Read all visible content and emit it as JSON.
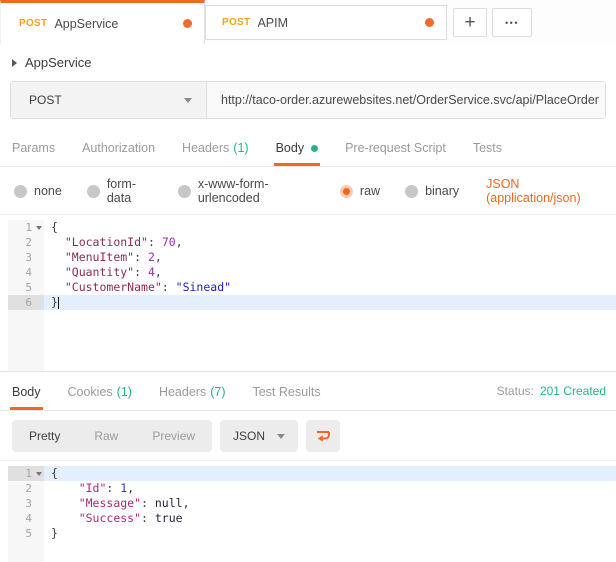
{
  "colors": {
    "accent_orange": "#F26722",
    "method_orange": "#F9A11B",
    "green": "#26B47F",
    "active_line_blue": "#E3EFFC"
  },
  "tabbar": {
    "tabs": [
      {
        "method": "POST",
        "title": "AppService",
        "modified": true,
        "active": true
      },
      {
        "method": "POST",
        "title": "APIM",
        "modified": true,
        "active": false
      }
    ],
    "new_tab_label": "+",
    "more_label": "•••"
  },
  "breadcrumb": {
    "title": "AppService"
  },
  "request": {
    "method": "POST",
    "url": "http://taco-order.azurewebsites.net/OrderService.svc/api/PlaceOrder",
    "tabs": [
      {
        "label": "Params"
      },
      {
        "label": "Authorization"
      },
      {
        "label": "Headers",
        "count": "(1)"
      },
      {
        "label": "Body",
        "modified": true,
        "active": true
      },
      {
        "label": "Pre-request Script"
      },
      {
        "label": "Tests"
      }
    ],
    "body_modes": [
      {
        "label": "none"
      },
      {
        "label": "form-data"
      },
      {
        "label": "x-www-form-urlencoded"
      },
      {
        "label": "raw",
        "selected": true
      },
      {
        "label": "binary"
      }
    ],
    "content_type": "JSON (application/json)",
    "body_lines": [
      {
        "num": 1,
        "fold": true,
        "tokens": [
          {
            "t": "{",
            "c": "pln"
          }
        ]
      },
      {
        "num": 2,
        "tokens": [
          {
            "t": "  ",
            "c": "pln"
          },
          {
            "t": "\"LocationId\"",
            "c": "rqk"
          },
          {
            "t": ": ",
            "c": "pln"
          },
          {
            "t": "70",
            "c": "rqn"
          },
          {
            "t": ",",
            "c": "pln"
          }
        ]
      },
      {
        "num": 3,
        "tokens": [
          {
            "t": "  ",
            "c": "pln"
          },
          {
            "t": "\"MenuItem\"",
            "c": "rqk"
          },
          {
            "t": ": ",
            "c": "pln"
          },
          {
            "t": "2",
            "c": "rqn"
          },
          {
            "t": ",",
            "c": "pln"
          }
        ]
      },
      {
        "num": 4,
        "tokens": [
          {
            "t": "  ",
            "c": "pln"
          },
          {
            "t": "\"Quantity\"",
            "c": "rqk"
          },
          {
            "t": ": ",
            "c": "pln"
          },
          {
            "t": "4",
            "c": "rqn"
          },
          {
            "t": ",",
            "c": "pln"
          }
        ]
      },
      {
        "num": 5,
        "tokens": [
          {
            "t": "  ",
            "c": "pln"
          },
          {
            "t": "\"CustomerName\"",
            "c": "rqk"
          },
          {
            "t": ": ",
            "c": "pln"
          },
          {
            "t": "\"Sinead\"",
            "c": "rqs"
          }
        ]
      },
      {
        "num": 6,
        "active": true,
        "caret": true,
        "tokens": [
          {
            "t": "}",
            "c": "pln"
          }
        ]
      }
    ]
  },
  "response": {
    "tabs": [
      {
        "label": "Body",
        "active": true
      },
      {
        "label": "Cookies",
        "count": "(1)"
      },
      {
        "label": "Headers",
        "count": "(7)"
      },
      {
        "label": "Test Results"
      }
    ],
    "status_label": "Status:",
    "status_value": "201 Created",
    "view_buttons": [
      {
        "label": "Pretty",
        "active": true
      },
      {
        "label": "Raw"
      },
      {
        "label": "Preview"
      }
    ],
    "format": "JSON",
    "body_lines": [
      {
        "num": 1,
        "fold": true,
        "active": true,
        "tokens": [
          {
            "t": "{",
            "c": "pln"
          }
        ]
      },
      {
        "num": 2,
        "tokens": [
          {
            "t": "    ",
            "c": "pln"
          },
          {
            "t": "\"Id\"",
            "c": "rsk"
          },
          {
            "t": ": ",
            "c": "pln"
          },
          {
            "t": "1",
            "c": "rsn"
          },
          {
            "t": ",",
            "c": "pln"
          }
        ]
      },
      {
        "num": 3,
        "tokens": [
          {
            "t": "    ",
            "c": "pln"
          },
          {
            "t": "\"Message\"",
            "c": "rsk"
          },
          {
            "t": ": ",
            "c": "pln"
          },
          {
            "t": "null",
            "c": "rsl"
          },
          {
            "t": ",",
            "c": "pln"
          }
        ]
      },
      {
        "num": 4,
        "tokens": [
          {
            "t": "    ",
            "c": "pln"
          },
          {
            "t": "\"Success\"",
            "c": "rsk"
          },
          {
            "t": ": ",
            "c": "pln"
          },
          {
            "t": "true",
            "c": "rsl"
          }
        ]
      },
      {
        "num": 5,
        "tokens": [
          {
            "t": "}",
            "c": "pln"
          }
        ]
      }
    ]
  }
}
